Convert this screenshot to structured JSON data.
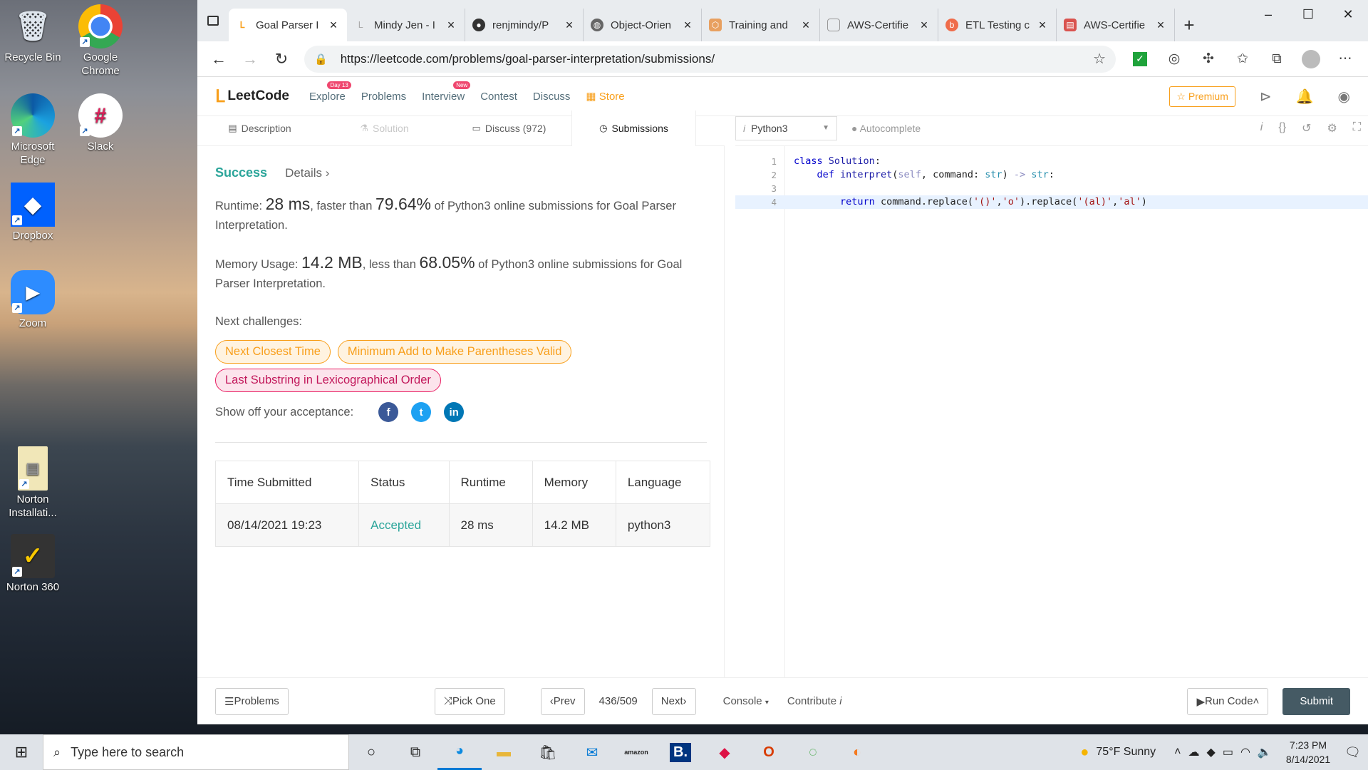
{
  "desktop": {
    "icons": [
      {
        "label": "Recycle Bin",
        "icon": "recycle-bin-icon"
      },
      {
        "label": "Google Chrome",
        "icon": "chrome-icon"
      },
      {
        "label": "Microsoft Edge",
        "icon": "edge-icon"
      },
      {
        "label": "Slack",
        "icon": "slack-icon"
      },
      {
        "label": "Dropbox",
        "icon": "dropbox-icon"
      },
      {
        "label": "Zoom",
        "icon": "zoom-icon"
      },
      {
        "label": "Norton Installati...",
        "icon": "norton-installer-icon"
      },
      {
        "label": "Norton 360",
        "icon": "norton-360-icon"
      }
    ]
  },
  "browser": {
    "tabs": [
      {
        "title": "Goal Parser I",
        "active": true,
        "color": "#f89f1b"
      },
      {
        "title": "Mindy Jen - I",
        "active": false,
        "color": "#bbbbbb"
      },
      {
        "title": "renjmindy/P",
        "active": false,
        "color": "#333333"
      },
      {
        "title": "Object-Orien",
        "active": false,
        "color": "#666666"
      },
      {
        "title": "Training and",
        "active": false,
        "color": "#e8a060"
      },
      {
        "title": "AWS-Certifie",
        "active": false,
        "color": "#888888"
      },
      {
        "title": "ETL Testing c",
        "active": false,
        "color": "#ef6c4a"
      },
      {
        "title": "AWS-Certifie",
        "active": false,
        "color": "#d9534f"
      }
    ],
    "url": "https://leetcode.com/problems/goal-parser-interpretation/submissions/"
  },
  "leetcode": {
    "logo": "LeetCode",
    "nav": {
      "explore": "Explore",
      "explore_badge": "Day 13",
      "problems": "Problems",
      "interview": "Interview",
      "interview_badge": "New",
      "contest": "Contest",
      "discuss": "Discuss",
      "store": "Store",
      "premium": "Premium"
    },
    "subtabs": {
      "description": "Description",
      "solution": "Solution",
      "discuss": "Discuss (972)",
      "submissions": "Submissions"
    },
    "result": {
      "status": "Success",
      "details": "Details",
      "runtime_label": "Runtime:",
      "runtime_value": "28 ms",
      "runtime_mid": ", faster than",
      "runtime_pct": "79.64%",
      "runtime_tail": "of Python3 online submissions for Goal Parser Interpretation.",
      "memory_label": "Memory Usage:",
      "memory_value": "14.2 MB",
      "memory_mid": ", less than",
      "memory_pct": "68.05%",
      "memory_tail": "of Python3 online submissions for Goal Parser Interpretation.",
      "next_label": "Next challenges:",
      "challenges": [
        {
          "title": "Next Closest Time",
          "difficulty": "medium"
        },
        {
          "title": "Minimum Add to Make Parentheses Valid",
          "difficulty": "medium"
        },
        {
          "title": "Last Substring in Lexicographical Order",
          "difficulty": "hard"
        }
      ],
      "share_label": "Show off your acceptance:"
    },
    "table": {
      "headers": [
        "Time Submitted",
        "Status",
        "Runtime",
        "Memory",
        "Language"
      ],
      "rows": [
        [
          "08/14/2021 19:23",
          "Accepted",
          "28 ms",
          "14.2 MB",
          "python3"
        ]
      ]
    },
    "editor": {
      "language": "Python3",
      "autocomplete": "Autocomplete",
      "line_numbers": [
        "1",
        "2",
        "3",
        "4"
      ]
    },
    "bottom": {
      "problems": "Problems",
      "pick_one": "Pick One",
      "prev": "Prev",
      "page": "436/509",
      "next": "Next",
      "console": "Console",
      "contribute": "Contribute",
      "run_code": "Run Code",
      "submit": "Submit"
    }
  },
  "taskbar": {
    "search_placeholder": "Type here to search",
    "weather": "75°F  Sunny",
    "time": "7:23 PM",
    "date": "8/14/2021"
  }
}
